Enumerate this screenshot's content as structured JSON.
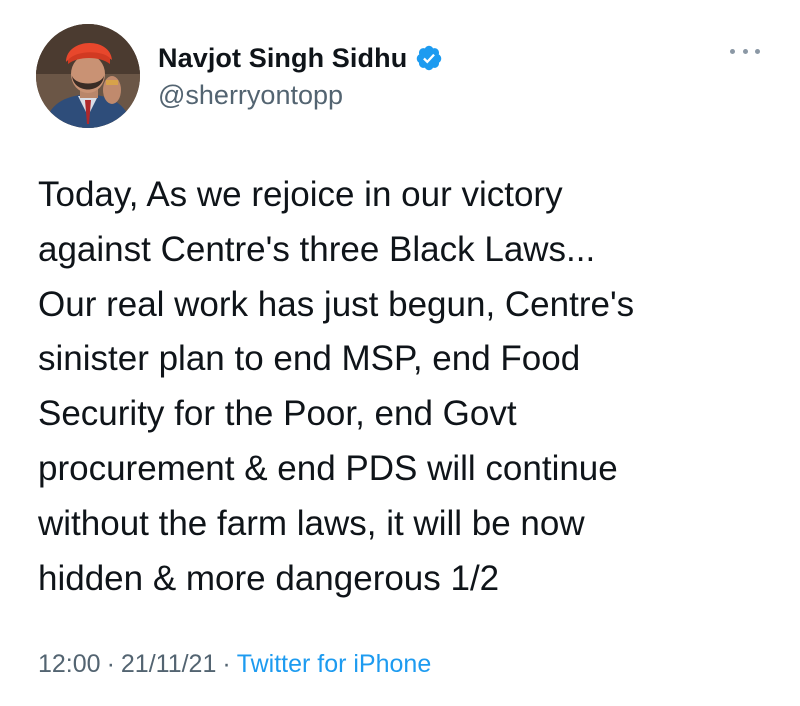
{
  "author": {
    "display_name": "Navjot Singh Sidhu",
    "handle": "@sherryontopp",
    "verified": true
  },
  "tweet": {
    "text": "Today, As we rejoice in our victory\nagainst Centre's three Black Laws...\nOur real work has just begun, Centre's\nsinister plan to end MSP, end Food\nSecurity for the Poor, end Govt\nprocurement & end PDS will continue\nwithout the farm laws, it will be now\nhidden & more dangerous 1/2"
  },
  "meta": {
    "time": "12:00",
    "separator": "·",
    "date": "21/11/21",
    "source": "Twitter for iPhone"
  },
  "colors": {
    "verified_badge": "#1d9bf0",
    "link": "#1d9bf0",
    "secondary_text": "#536471",
    "turban": "#e8472c"
  },
  "icons": {
    "verified": "verified-badge-icon",
    "more": "more-options-icon"
  }
}
